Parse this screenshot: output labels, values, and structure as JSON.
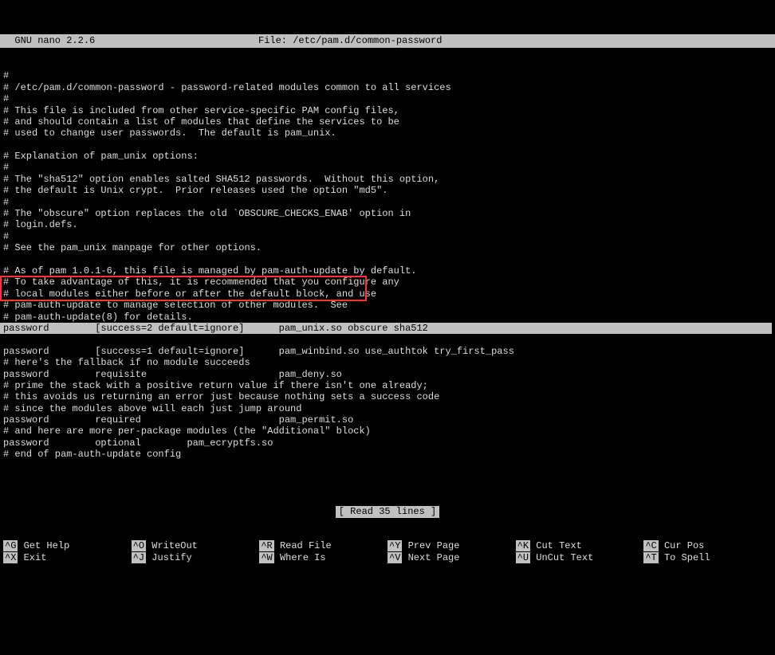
{
  "header": {
    "app": "  GNU nano 2.2.6",
    "file": "File: /etc/pam.d/common-password"
  },
  "lines": [
    "#",
    "# /etc/pam.d/common-password - password-related modules common to all services",
    "#",
    "# This file is included from other service-specific PAM config files,",
    "# and should contain a list of modules that define the services to be",
    "# used to change user passwords.  The default is pam_unix.",
    "",
    "# Explanation of pam_unix options:",
    "#",
    "# The \"sha512\" option enables salted SHA512 passwords.  Without this option,",
    "# the default is Unix crypt.  Prior releases used the option \"md5\".",
    "#",
    "# The \"obscure\" option replaces the old `OBSCURE_CHECKS_ENAB' option in",
    "# login.defs.",
    "#",
    "# See the pam_unix manpage for other options.",
    "",
    "# As of pam 1.0.1-6, this file is managed by pam-auth-update by default.",
    "# To take advantage of this, it is recommended that you configure any",
    "# local modules either before or after the default block, and use",
    "# pam-auth-update to manage selection of other modules.  See",
    "# pam-auth-update(8) for details.",
    "password        [success=2 default=ignore]      pam_unix.so obscure sha512",
    "password        [success=1 default=ignore]      pam_winbind.so use_authtok try_first_pass",
    "# here's the fallback if no module succeeds",
    "password        requisite                       pam_deny.so",
    "# prime the stack with a positive return value if there isn't one already;",
    "# this avoids us returning an error just because nothing sets a success code",
    "# since the modules above will each just jump around",
    "password        required                        pam_permit.so",
    "# and here are more per-package modules (the \"Additional\" block)",
    "password        optional        pam_ecryptfs.so",
    "# end of pam-auth-update config"
  ],
  "status": "[ Read 35 lines ]",
  "shortcuts": [
    {
      "key": "^G",
      "label": "Get Help"
    },
    {
      "key": "^O",
      "label": "WriteOut"
    },
    {
      "key": "^R",
      "label": "Read File"
    },
    {
      "key": "^Y",
      "label": "Prev Page"
    },
    {
      "key": "^K",
      "label": "Cut Text"
    },
    {
      "key": "^C",
      "label": "Cur Pos"
    },
    {
      "key": "^X",
      "label": "Exit"
    },
    {
      "key": "^J",
      "label": "Justify"
    },
    {
      "key": "^W",
      "label": "Where Is"
    },
    {
      "key": "^V",
      "label": "Next Page"
    },
    {
      "key": "^U",
      "label": "UnCut Text"
    },
    {
      "key": "^T",
      "label": "To Spell"
    }
  ]
}
